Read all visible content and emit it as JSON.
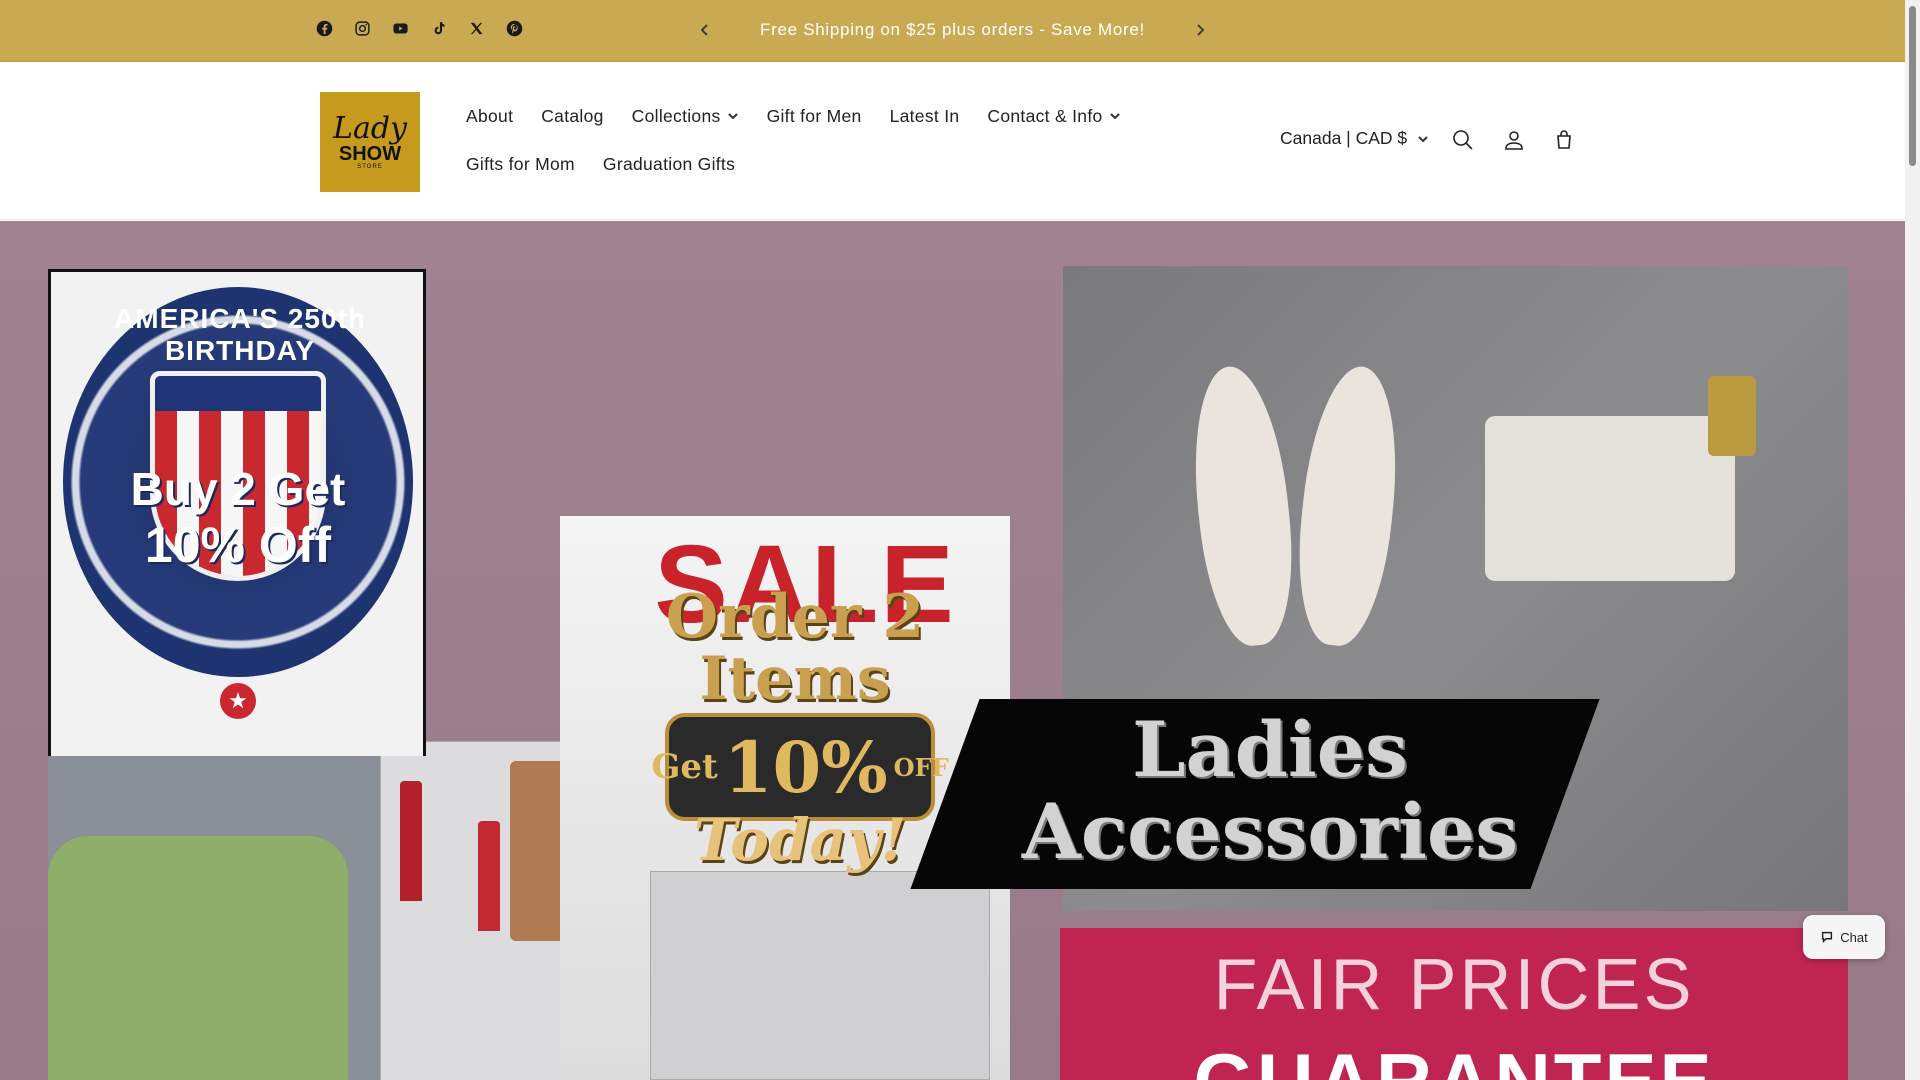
{
  "announcement": {
    "text": "Free Shipping on $25 plus orders - Save More!",
    "social_icons": [
      "facebook-icon",
      "instagram-icon",
      "youtube-icon",
      "tiktok-icon",
      "x-icon",
      "pinterest-icon"
    ]
  },
  "logo": {
    "line1": "Lady",
    "line2": "SHOW",
    "line3": "STORE"
  },
  "nav": {
    "row1": [
      {
        "label": "About",
        "dropdown": false
      },
      {
        "label": "Catalog",
        "dropdown": false
      },
      {
        "label": "Collections",
        "dropdown": true
      },
      {
        "label": "Gift for Men",
        "dropdown": false
      },
      {
        "label": "Latest In",
        "dropdown": false
      },
      {
        "label": "Contact & Info",
        "dropdown": true
      }
    ],
    "row2": [
      {
        "label": "Gifts for Mom",
        "dropdown": false
      },
      {
        "label": "Graduation Gifts",
        "dropdown": false
      }
    ]
  },
  "header": {
    "currency": "Canada | CAD $"
  },
  "hero": {
    "badge_ring": "AMERICA'S 250th BIRTHDAY",
    "badge_line1": "Buy 2 Get",
    "badge_line2": "10% Off",
    "sale": "SALE",
    "order_line1": "Order 2",
    "order_line2": "Items",
    "get": "Get",
    "percent": "10%",
    "off": "OFF",
    "today": "Today!",
    "acc_line1": "Ladies",
    "acc_line2": "Accessories",
    "fair_line1": "FAIR PRICES",
    "fair_line2": "GUARANTEE"
  },
  "chat": {
    "label": "Chat"
  },
  "colors": {
    "announcement_bg": "#c9aa52",
    "hero_bg": "#9b7e8c",
    "accent_red": "#c8232b",
    "fair_bg": "#c02552"
  }
}
